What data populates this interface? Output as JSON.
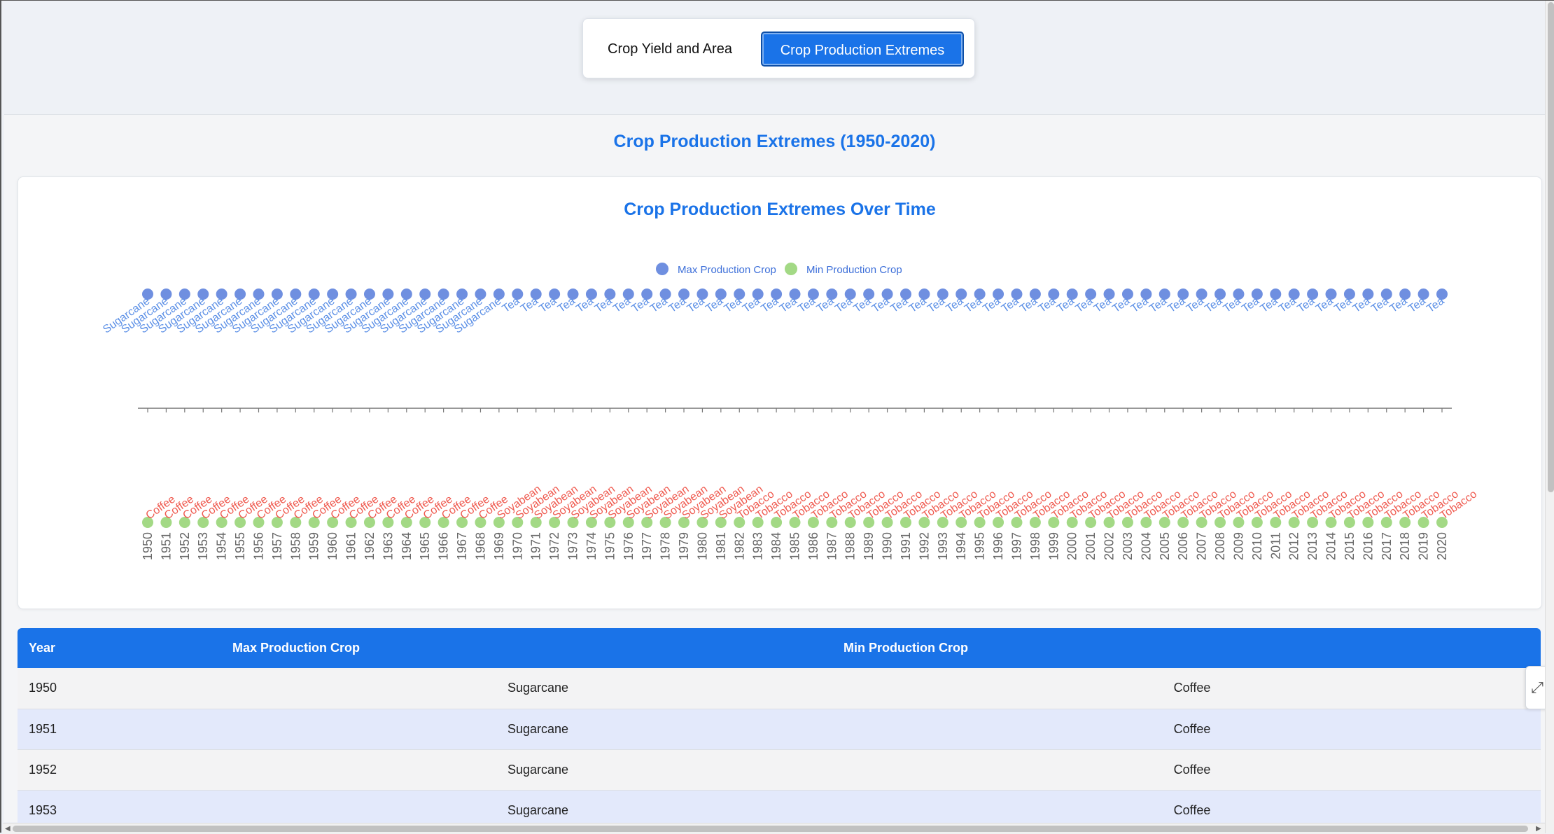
{
  "tabs": [
    {
      "label": "Crop Yield and Area",
      "active": false
    },
    {
      "label": "Crop Production Extremes",
      "active": true
    }
  ],
  "page_title": "Crop Production Extremes (1950-2020)",
  "chart_data": {
    "type": "scatter",
    "title": "Crop Production Extremes Over Time",
    "legend": [
      {
        "name": "Max Production Crop",
        "color": "#6f8fe0"
      },
      {
        "name": "Min Production Crop",
        "color": "#a3d985"
      }
    ],
    "legend_position": "top-center",
    "x": [
      1950,
      1951,
      1952,
      1953,
      1954,
      1955,
      1956,
      1957,
      1958,
      1959,
      1960,
      1961,
      1962,
      1963,
      1964,
      1965,
      1966,
      1967,
      1968,
      1969,
      1970,
      1971,
      1972,
      1973,
      1974,
      1975,
      1976,
      1977,
      1978,
      1979,
      1980,
      1981,
      1982,
      1983,
      1984,
      1985,
      1986,
      1987,
      1988,
      1989,
      1990,
      1991,
      1992,
      1993,
      1994,
      1995,
      1996,
      1997,
      1998,
      1999,
      2000,
      2001,
      2002,
      2003,
      2004,
      2005,
      2006,
      2007,
      2008,
      2009,
      2010,
      2011,
      2012,
      2013,
      2014,
      2015,
      2016,
      2017,
      2018,
      2019,
      2020
    ],
    "series": [
      {
        "name": "Max Production Crop",
        "segments": [
          {
            "from": 1950,
            "to": 1969,
            "crop": "Sugarcane"
          },
          {
            "from": 1970,
            "to": 2020,
            "crop": "Tea"
          }
        ],
        "label_color": "#5b8fe6"
      },
      {
        "name": "Min Production Crop",
        "segments": [
          {
            "from": 1950,
            "to": 1968,
            "crop": "Coffee"
          },
          {
            "from": 1969,
            "to": 1981,
            "crop": "Soyabean"
          },
          {
            "from": 1982,
            "to": 2020,
            "crop": "Tobacco"
          }
        ],
        "label_color": "#ef5a4f"
      }
    ],
    "grid": false
  },
  "table": {
    "headers": {
      "year": "Year",
      "max": "Max Production Crop",
      "min": "Min Production Crop"
    },
    "rows": [
      {
        "year": "1950",
        "max": "Sugarcane",
        "min": "Coffee"
      },
      {
        "year": "1951",
        "max": "Sugarcane",
        "min": "Coffee"
      },
      {
        "year": "1952",
        "max": "Sugarcane",
        "min": "Coffee"
      },
      {
        "year": "1953",
        "max": "Sugarcane",
        "min": "Coffee"
      }
    ]
  },
  "icons": {
    "expand": "expand-arrows-icon",
    "scroll_left": "chevron-left-icon",
    "scroll_right": "chevron-right-icon"
  }
}
